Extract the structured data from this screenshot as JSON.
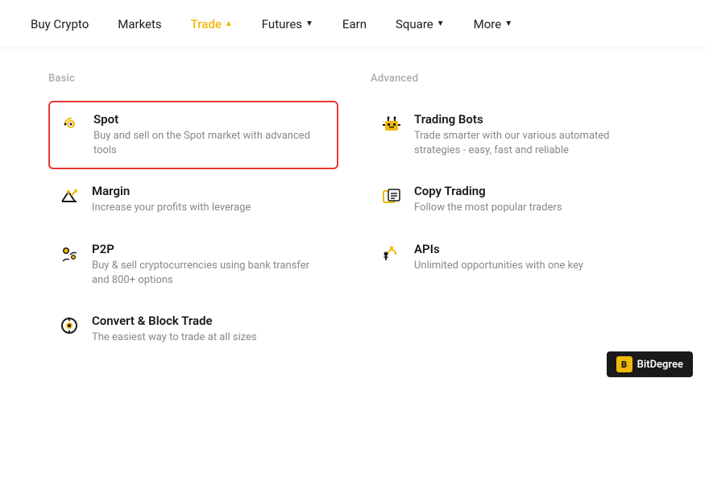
{
  "navbar": {
    "items": [
      {
        "id": "buy-crypto",
        "label": "Buy Crypto",
        "active": false,
        "hasDropdown": false
      },
      {
        "id": "markets",
        "label": "Markets",
        "active": false,
        "hasDropdown": false
      },
      {
        "id": "trade",
        "label": "Trade",
        "active": true,
        "hasDropdown": true,
        "chevron": "▲"
      },
      {
        "id": "futures",
        "label": "Futures",
        "active": false,
        "hasDropdown": true,
        "chevron": "▼"
      },
      {
        "id": "earn",
        "label": "Earn",
        "active": false,
        "hasDropdown": false
      },
      {
        "id": "square",
        "label": "Square",
        "active": false,
        "hasDropdown": true,
        "chevron": "▼"
      },
      {
        "id": "more",
        "label": "More",
        "active": false,
        "hasDropdown": true,
        "chevron": "▼"
      }
    ]
  },
  "dropdown": {
    "basic": {
      "title": "Basic",
      "items": [
        {
          "id": "spot",
          "title": "Spot",
          "desc": "Buy and sell on the Spot market with advanced tools",
          "highlighted": true
        },
        {
          "id": "margin",
          "title": "Margin",
          "desc": "Increase your profits with leverage",
          "highlighted": false
        },
        {
          "id": "p2p",
          "title": "P2P",
          "desc": "Buy & sell cryptocurrencies using bank transfer and 800+ options",
          "highlighted": false
        },
        {
          "id": "convert",
          "title": "Convert & Block Trade",
          "desc": "The easiest way to trade at all sizes",
          "highlighted": false
        }
      ]
    },
    "advanced": {
      "title": "Advanced",
      "items": [
        {
          "id": "trading-bots",
          "title": "Trading Bots",
          "desc": "Trade smarter with our various automated strategies - easy, fast and reliable",
          "highlighted": false
        },
        {
          "id": "copy-trading",
          "title": "Copy Trading",
          "desc": "Follow the most popular traders",
          "highlighted": false
        },
        {
          "id": "apis",
          "title": "APIs",
          "desc": "Unlimited opportunities with one key",
          "highlighted": false
        }
      ]
    }
  },
  "bitdegree": {
    "icon_label": "B",
    "label": "BitDegree"
  }
}
